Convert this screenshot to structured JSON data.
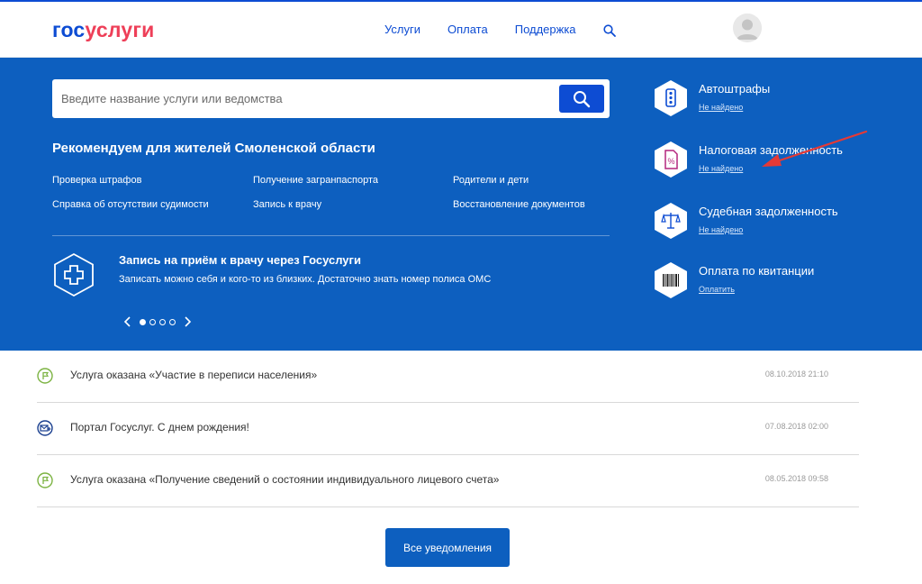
{
  "header": {
    "logo_part1": "гос",
    "logo_part2": "услуги",
    "nav": [
      "Услуги",
      "Оплата",
      "Поддержка"
    ]
  },
  "search": {
    "placeholder": "Введите название услуги или ведомства"
  },
  "recommend": {
    "title": "Рекомендуем для жителей Смоленской области",
    "links": [
      "Проверка штрафов",
      "Получение загранпаспорта",
      "Родители и дети",
      "Справка об отсутствии судимости",
      "Запись к врачу",
      "Восстановление документов"
    ]
  },
  "promo": {
    "title": "Запись на приём к врачу через Госуслуги",
    "text": "Записать можно себя и кого-то из близких. Достаточно знать номер полиса ОМС"
  },
  "carousel": {
    "slides": 4,
    "active": 1
  },
  "quick": [
    {
      "title": "Автоштрафы",
      "link": "Не найдено",
      "icon": "traffic-light-icon"
    },
    {
      "title": "Налоговая задолженность",
      "link": "Не найдено",
      "icon": "tax-document-icon"
    },
    {
      "title": "Судебная задолженность",
      "link": "Не найдено",
      "icon": "scales-icon"
    },
    {
      "title": "Оплата по квитанции",
      "link": "Оплатить",
      "icon": "barcode-icon"
    }
  ],
  "feed": [
    {
      "text": "Услуга оказана «Участие в переписи населения»",
      "date": "08.10.2018 21:10",
      "icon": "flag-icon"
    },
    {
      "text": "Портал Госуслуг. С днем рождения!",
      "date": "07.08.2018 02:00",
      "icon": "mail-icon"
    },
    {
      "text": "Услуга оказана «Получение сведений о состоянии индивидуального лицевого счета»",
      "date": "08.05.2018 09:58",
      "icon": "flag-icon"
    }
  ],
  "all_notifications": "Все уведомления",
  "colors": {
    "brand_blue": "#0d4cd3",
    "hero_blue": "#0d5fbf",
    "logo_red": "#ee3f58",
    "annotation_red": "#e53935"
  }
}
